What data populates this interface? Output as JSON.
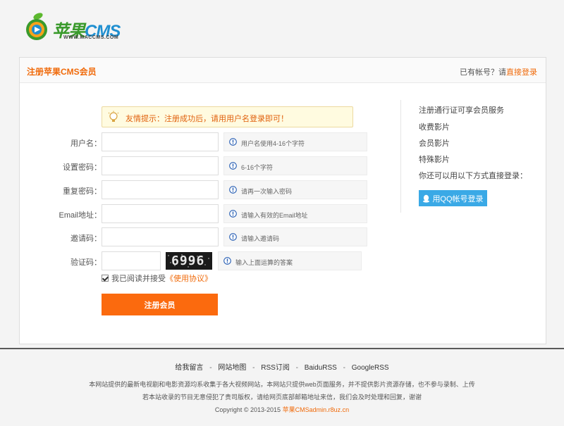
{
  "logo": {
    "brand_a": "苹果",
    "brand_b": "CMS",
    "domain": "WWW.MACCMS.COM"
  },
  "panel": {
    "title": "注册苹果CMS会员",
    "login_prefix": "已有帐号？请",
    "login_link": "直接登录"
  },
  "tip": {
    "text": "友情提示：注册成功后，请用用户名登录即可！"
  },
  "form": {
    "rows": [
      {
        "label": "用户名：",
        "hint": "用户名使用4-16个字符"
      },
      {
        "label": "设置密码：",
        "hint": "6-16个字符"
      },
      {
        "label": "重复密码：",
        "hint": "请再一次输入密码"
      },
      {
        "label": "Email地址：",
        "hint": "请输入有效的Email地址"
      },
      {
        "label": "邀请码：",
        "hint": "请输入邀请码"
      }
    ],
    "captcha": {
      "label": "验证码：",
      "image_text": "6996",
      "hint": "输入上面运算的答案"
    },
    "agree_text": "我已阅读并接受",
    "agree_link": "《使用协议》",
    "submit_label": "注册会员"
  },
  "side": {
    "items": [
      "注册通行证可享会员服务",
      "收费影片",
      "会员影片",
      "特殊影片",
      "你还可以用以下方式直接登录："
    ],
    "qq_label": "用QQ帐号登录"
  },
  "footer": {
    "links": [
      "给我留言",
      "网站地图",
      "RSS订阅",
      "BaiduRSS",
      "GoogleRSS"
    ],
    "separator": "-",
    "line1": "本网站提供的最新电视剧和电影资源均系收集于各大视频网站，本网站只提供web页面服务，并不提供影片资源存储，也不参与录制、上传",
    "line2": "若本站收录的节目无意侵犯了贵司版权，请给网页底部邮箱地址来信，我们会及时处理和回复，谢谢",
    "copy_prefix": "Copyright © 2013-2015",
    "copy_link": "苹果CMSadmin.r8uz.cn"
  },
  "colors": {
    "accent": "#f06a0a",
    "button": "#fb6a0e",
    "qq": "#3aa9e6"
  }
}
